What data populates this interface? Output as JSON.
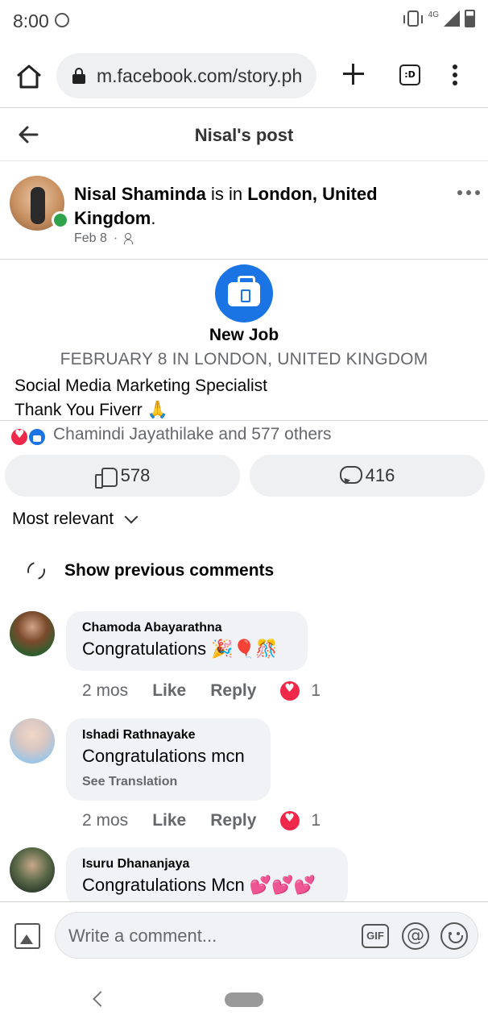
{
  "status_bar": {
    "time": "8:00",
    "network": "4G"
  },
  "browser": {
    "url": "m.facebook.com/story.ph",
    "tabs_label": ":D"
  },
  "header": {
    "title": "Nisal's post"
  },
  "post": {
    "author": "Nisal Shaminda",
    "connector": "is in",
    "location": "London, United Kingdom",
    "end": ".",
    "date": "Feb 8",
    "separator": "·"
  },
  "life_event": {
    "title": "New Job",
    "subtitle": "FEBRUARY 8 IN LONDON, UNITED KINGDOM",
    "line1": "Social Media Marketing Specialist",
    "line2": "Thank You Fiverr 🙏"
  },
  "reactions": {
    "summary": "Chamindi Jayathilake and 577 others",
    "like_count": "578",
    "comment_count": "416"
  },
  "sort": {
    "label": "Most relevant"
  },
  "show_previous": "Show previous comments",
  "comments": [
    {
      "name": "Chamoda Abayarathna",
      "text": "Congratulations 🎉🎈🎊",
      "time": "2 mos",
      "like": "Like",
      "reply": "Reply",
      "reaction_count": "1"
    },
    {
      "name": "Ishadi Rathnayake",
      "text": "Congratulations mcn",
      "translate": "See Translation",
      "time": "2 mos",
      "like": "Like",
      "reply": "Reply",
      "reaction_count": "1"
    },
    {
      "name": "Isuru Dhananjaya",
      "text": "Congratulations Mcn 💕💕💕"
    }
  ],
  "composer": {
    "placeholder": "Write a comment...",
    "gif_label": "GIF",
    "at_label": "@"
  },
  "colors": {
    "accent": "#1b74e4",
    "love": "#f02849",
    "online": "#31a24c",
    "secondary_text": "#65676b"
  }
}
